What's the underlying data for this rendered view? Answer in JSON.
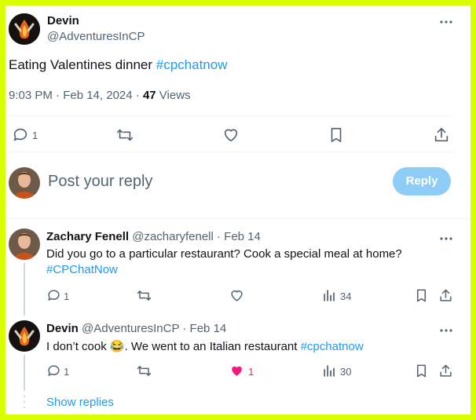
{
  "tweet": {
    "author_name": "Devin",
    "author_handle": "@AdventuresInCP",
    "text_plain": "Eating Valentines dinner ",
    "text_hashtag": "#cpchatnow",
    "timestamp": "9:03 PM · Feb 14, 2024",
    "views_sep": " · ",
    "views_count": "47",
    "views_label": " Views",
    "actions": {
      "reply_count": "1"
    }
  },
  "composer": {
    "placeholder": "Post your reply",
    "button_label": "Reply"
  },
  "replies": [
    {
      "author_name": "Zachary Fenell",
      "author_handle": "@zacharyfenell",
      "date": " · Feb 14",
      "text": "Did you go to a particular restaurant? Cook a special meal at home?",
      "hashtag": "#CPChatNow",
      "reply_count": "1",
      "like_count": "",
      "views": "34"
    },
    {
      "author_name": "Devin",
      "author_handle": "@AdventuresInCP",
      "date": " · Feb 14",
      "text_before": "I don’t cook ",
      "emoji": "😂",
      "text_after": ". We went to an Italian restaurant ",
      "hashtag": "#cpchatnow",
      "reply_count": "1",
      "like_count": "1",
      "views": "30"
    }
  ],
  "show_replies": "Show replies",
  "colors": {
    "accent": "#1d9bf0",
    "like": "#f91880",
    "frame": "#d7ff00",
    "reply_button": "#8ecdf8"
  }
}
